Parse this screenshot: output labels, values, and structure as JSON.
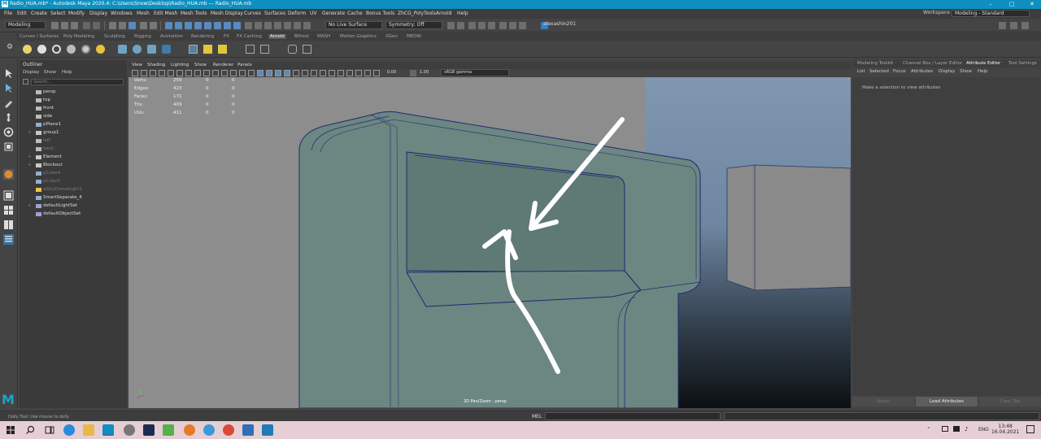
{
  "window": {
    "title": "Radio_HUA.mb* - Autodesk Maya 2020.4: C:\\Users\\Snow\\Desktop\\Radio_HUA.mb  ---  Radio_HUA.mb",
    "app_icon": "M"
  },
  "menubar": {
    "items": [
      "File",
      "Edit",
      "Create",
      "Select",
      "Modify",
      "Display",
      "Windows",
      "Mesh",
      "Edit Mesh",
      "Mesh Tools",
      "Mesh Display",
      "Curves",
      "Surfaces",
      "Deform",
      "UV",
      "Generate",
      "Cache",
      "Bonus Tools",
      "ZhCG_PolyTools",
      "Arnold",
      "Help"
    ],
    "workspace_label": "Workspace :",
    "workspace_value": "Modeling - Standard"
  },
  "statusline": {
    "mode": "Modeling",
    "live_surface": "No Live Surface",
    "symmetry": "Symmetry: Off",
    "user": "alexashin201"
  },
  "shelf": {
    "tabs": [
      "Curves / Surfaces",
      "Poly Modeling",
      "Sculpting",
      "Rigging",
      "Animation",
      "Rendering",
      "FX",
      "FX Caching",
      "Arnold",
      "Bifrost",
      "MASH",
      "Motion Graphics",
      "XGen",
      "MEOW"
    ],
    "active_tab": "Arnold"
  },
  "outliner": {
    "title": "Outliner",
    "menu": [
      "Display",
      "Show",
      "Help"
    ],
    "search_placeholder": "Search...",
    "items": [
      {
        "label": "persp",
        "icon": "camera-icon",
        "dim": false,
        "expand": ""
      },
      {
        "label": "top",
        "icon": "camera-icon",
        "dim": false,
        "expand": ""
      },
      {
        "label": "front",
        "icon": "camera-icon",
        "dim": false,
        "expand": ""
      },
      {
        "label": "side",
        "icon": "camera-icon",
        "dim": false,
        "expand": ""
      },
      {
        "label": "pPlane1",
        "icon": "mesh-icon",
        "dim": false,
        "expand": ""
      },
      {
        "label": "group1",
        "icon": "group-icon",
        "dim": false,
        "expand": "+"
      },
      {
        "label": "left",
        "icon": "camera-icon",
        "dim": true,
        "expand": ""
      },
      {
        "label": "back",
        "icon": "camera-icon",
        "dim": true,
        "expand": ""
      },
      {
        "label": "Element",
        "icon": "group-icon",
        "dim": false,
        "expand": "+"
      },
      {
        "label": "Blockout",
        "icon": "group-icon",
        "dim": false,
        "expand": "+"
      },
      {
        "label": "pCube4",
        "icon": "mesh-icon",
        "dim": true,
        "expand": ""
      },
      {
        "label": "pCube5",
        "icon": "mesh-icon",
        "dim": true,
        "expand": ""
      },
      {
        "label": "aiSkyDomeLight1",
        "icon": "light-icon",
        "dim": true,
        "expand": ""
      },
      {
        "label": "SmartSeparate_4",
        "icon": "mesh-icon",
        "dim": false,
        "expand": ""
      },
      {
        "label": "defaultLightSet",
        "icon": "set-icon",
        "dim": false,
        "expand": "+"
      },
      {
        "label": "defaultObjectSet",
        "icon": "set-icon",
        "dim": false,
        "expand": ""
      }
    ]
  },
  "viewport": {
    "menu": [
      "View",
      "Shading",
      "Lighting",
      "Show",
      "Renderer",
      "Panels"
    ],
    "exposure": "0.00",
    "gamma": "1.00",
    "color_space": "sRGB gamma",
    "camera_label": "2D Pan/Zoom : persp",
    "hud": [
      {
        "label": "Verts:",
        "a": "259",
        "b": "0",
        "c": "0"
      },
      {
        "label": "Edges:",
        "a": "423",
        "b": "0",
        "c": "0"
      },
      {
        "label": "Faces:",
        "a": "171",
        "b": "0",
        "c": "0"
      },
      {
        "label": "Tris:",
        "a": "409",
        "b": "0",
        "c": "0"
      },
      {
        "label": "UVs:",
        "a": "411",
        "b": "0",
        "c": "0"
      }
    ]
  },
  "attribute_editor": {
    "tabs": [
      "Modeling Toolkit",
      "Channel Box / Layer Editor",
      "Attribute Editor",
      "Tool Settings"
    ],
    "active_tab": "Attribute Editor",
    "menu": [
      "List",
      "Selected",
      "Focus",
      "Attributes",
      "Display",
      "Show",
      "Help"
    ],
    "message": "Make a selection to view attributes",
    "buttons": [
      "Select",
      "Load Attributes",
      "Copy Tab"
    ]
  },
  "helpline": {
    "text": "Dolly Tool: Use mouse to dolly",
    "mel_label": "MEL"
  },
  "taskbar": {
    "lang": "ENG",
    "time": "13:48",
    "date": "16.04.2021"
  },
  "colors": {
    "title_bar": "#0e8fbf",
    "accent": "#1aa3c9",
    "mesh": "#6c8682",
    "wire": "#1e2a6e",
    "taskbar": "#e6cfd4"
  }
}
